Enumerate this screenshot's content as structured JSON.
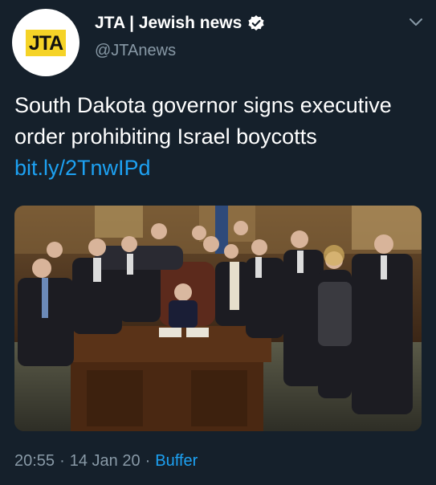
{
  "author": {
    "display_name": "JTA | Jewish news",
    "handle": "@JTAnews",
    "avatar_text": "JTA",
    "verified": true,
    "avatar_icon": "jta-logo"
  },
  "tweet": {
    "text": "South Dakota governor signs executive order prohibiting Israel boycotts",
    "link": "bit.ly/2TnwIPd"
  },
  "photo": {
    "description_icon": "photo-governor-signing"
  },
  "meta": {
    "time": "20:55",
    "date": "14 Jan 20",
    "source": "Buffer",
    "separator": "·"
  },
  "colors": {
    "background": "#15202b",
    "secondary_text": "#8899a6",
    "link": "#1da1f2",
    "logo_yellow": "#f5d327"
  }
}
